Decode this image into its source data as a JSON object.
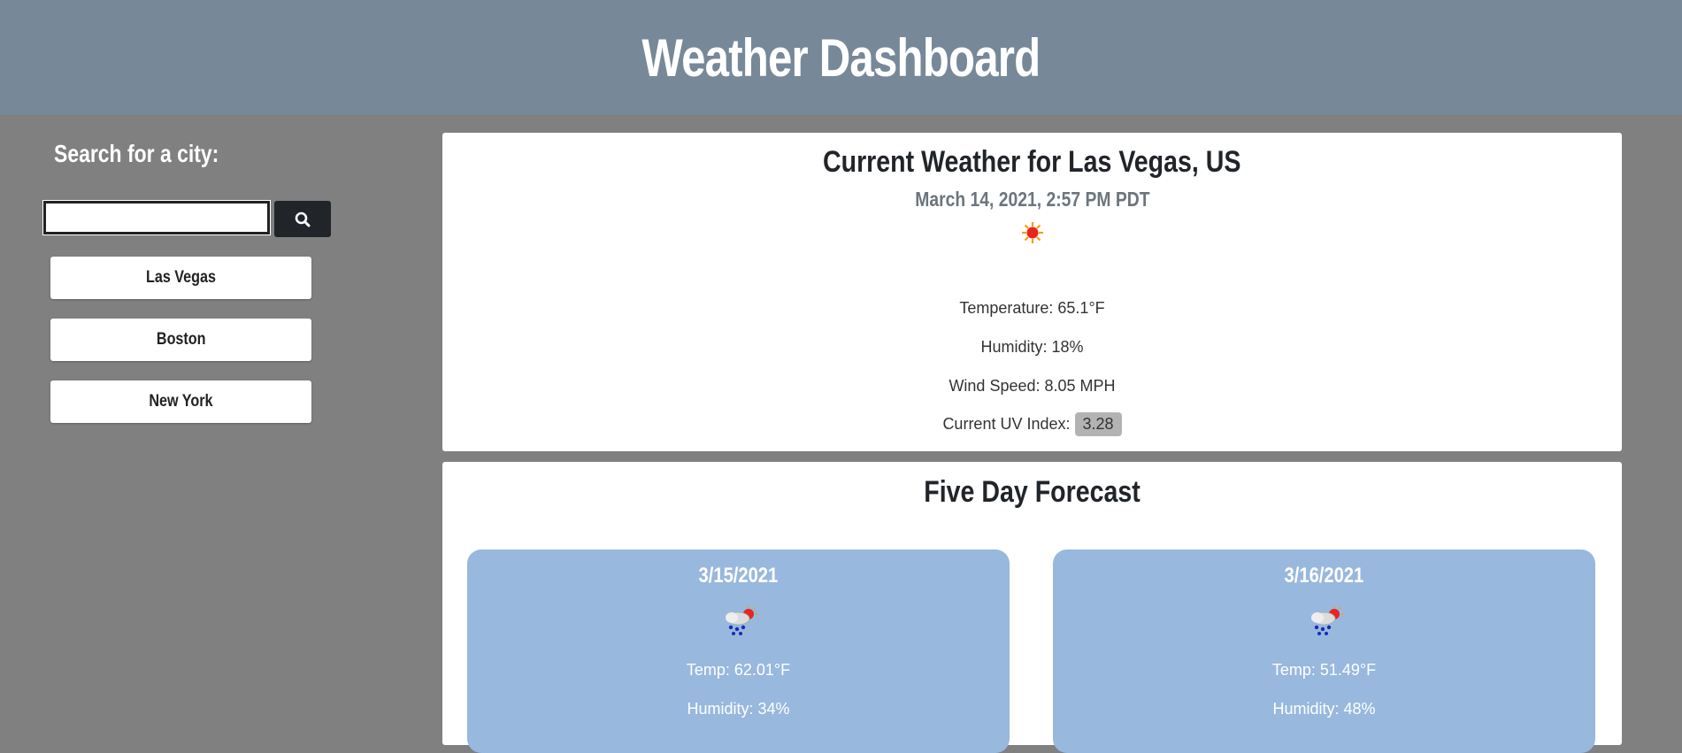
{
  "header": {
    "title": "Weather Dashboard"
  },
  "sidebar": {
    "search_label": "Search for a city:",
    "search_value": "",
    "cities": [
      "Las Vegas",
      "Boston",
      "New York"
    ]
  },
  "current": {
    "title": "Current Weather for Las Vegas, US",
    "date": "March 14, 2021, 2:57 PM PDT",
    "icon": "sun-icon",
    "temperature": "Temperature: 65.1°F",
    "humidity": "Humidity: 18%",
    "wind": "Wind Speed: 8.05 MPH",
    "uv_label": "Current UV Index:",
    "uv_value": "3.28"
  },
  "forecast": {
    "title": "Five Day Forecast",
    "days": [
      {
        "date": "3/15/2021",
        "icon": "rain-sun-icon",
        "temp": "Temp: 62.01°F",
        "humidity": "Humidity: 34%"
      },
      {
        "date": "3/16/2021",
        "icon": "rain-sun-icon",
        "temp": "Temp: 51.49°F",
        "humidity": "Humidity: 48%"
      }
    ]
  },
  "colors": {
    "header_bg": "#778899",
    "page_bg": "#808080",
    "forecast_card_bg": "#98b8de",
    "search_button_bg": "#212529",
    "uv_badge_bg": "#b3b3b3"
  }
}
